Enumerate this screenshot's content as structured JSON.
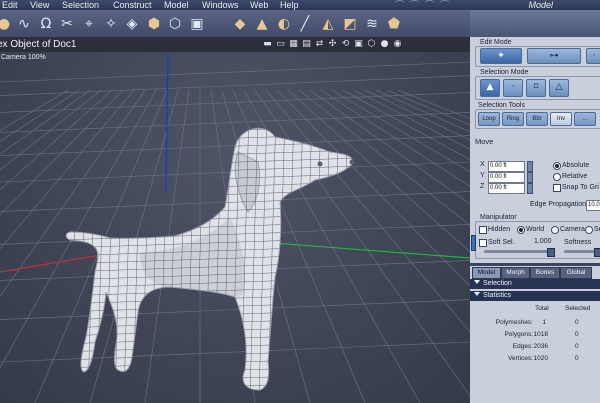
{
  "menubar": {
    "items": [
      "Edit",
      "View",
      "Selection",
      "Construct",
      "Model",
      "Windows",
      "Web",
      "Help"
    ],
    "mode_label": "Model"
  },
  "document": {
    "title": "ex Object of Doc1",
    "camera_label": "Camera 100%"
  },
  "toolbar_icons": [
    "sphere-tool-icon",
    "bezier-tool-icon",
    "magnet-tool-icon",
    "scissors-tool-icon",
    "knife-tool-icon",
    "smooth-tool-icon",
    "bevel-tool-icon",
    "extrude-tool-icon",
    "lathe-tool-icon",
    "boolean-tool-icon",
    "cube-tool-icon",
    "ball-tool-icon",
    "pen-tool-icon",
    "shape-tool-icon"
  ],
  "edit_mode": {
    "title": "Edit Mode",
    "buttons": [
      "vertex-mode-icon",
      "object-mode-icon"
    ]
  },
  "selection_mode": {
    "title": "Selection Mode",
    "buttons": [
      "pointer-select-icon",
      "lasso-select-icon",
      "rect-select-icon",
      "brush-select-icon"
    ]
  },
  "selection_tools": {
    "title": "Selection Tools",
    "buttons": [
      "Loop",
      "Ring",
      "Bbr",
      "Inv",
      "..."
    ]
  },
  "move": {
    "title": "Move",
    "x_label": "X",
    "x_value": "0.00 ft",
    "y_label": "Y",
    "y_value": "0.00 ft",
    "z_label": "Z",
    "z_value": "0.00 ft",
    "absolute_label": "Absolute",
    "relative_label": "Relative",
    "snap_label": "Snap To Gri",
    "edge_propagation_label": "Edge Propagation",
    "edge_propagation_value": "10.0",
    "coord_mode": "Absolute"
  },
  "manipulator": {
    "title": "Manipulator",
    "hidden_label": "Hidden",
    "world_label": "World",
    "camera_label": "Camera",
    "screen_label": "Se",
    "soft_sel_label": "Soft Sel.",
    "soft_sel_value": "1.000",
    "softness_label": "Softness",
    "space": "World"
  },
  "tabs": [
    "Model",
    "Morph",
    "Bones",
    "Global"
  ],
  "active_tab": "Model",
  "sections": {
    "selection": "Selection",
    "statistics": "Statistics"
  },
  "statistics": {
    "col_total": "Total",
    "col_selected": "Selected",
    "rows": [
      {
        "label": "Polymeshes:",
        "total": "1",
        "selected": "0"
      },
      {
        "label": "Polygons:",
        "total": "1018",
        "selected": "0"
      },
      {
        "label": "Edges:",
        "total": "2036",
        "selected": "0"
      },
      {
        "label": "Vertices:",
        "total": "1020",
        "selected": "0"
      }
    ]
  },
  "colors": {
    "viewport_bg": "#3e4454",
    "panel_bg": "#c9d0dc",
    "accent_blue": "#3b66a6",
    "mesh": "#e4e7ec"
  }
}
